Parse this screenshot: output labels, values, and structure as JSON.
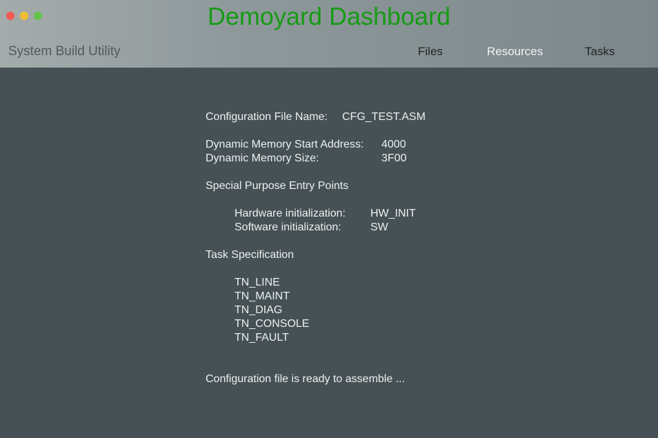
{
  "window": {
    "title": "Demoyard Dashboard",
    "subtitle": "System Build Utility"
  },
  "nav": {
    "items": [
      "Files",
      "Resources",
      "Tasks"
    ],
    "active": "Resources"
  },
  "config": {
    "file_label": "Configuration File Name:",
    "file_value": "CFG_TEST.ASM",
    "mem_start_label": "Dynamic Memory Start Address:",
    "mem_start_value": "4000",
    "mem_size_label": "Dynamic Memory Size:",
    "mem_size_value": "3F00",
    "entry_heading": "Special Purpose Entry Points",
    "hw_label": "Hardware initialization:",
    "hw_value": "HW_INIT",
    "sw_label": "Software initialization:",
    "sw_value": "SW",
    "task_heading": "Task Specification",
    "tasks": [
      "TN_LINE",
      "TN_MAINT",
      "TN_DIAG",
      "TN_CONSOLE",
      "TN_FAULT"
    ],
    "status": "Configuration file is ready to assemble ..."
  },
  "colors": {
    "title_green": "#169b14",
    "background": "#465155",
    "close": "#f25a53",
    "minimize": "#f3bd2f",
    "maximize": "#62c447"
  }
}
